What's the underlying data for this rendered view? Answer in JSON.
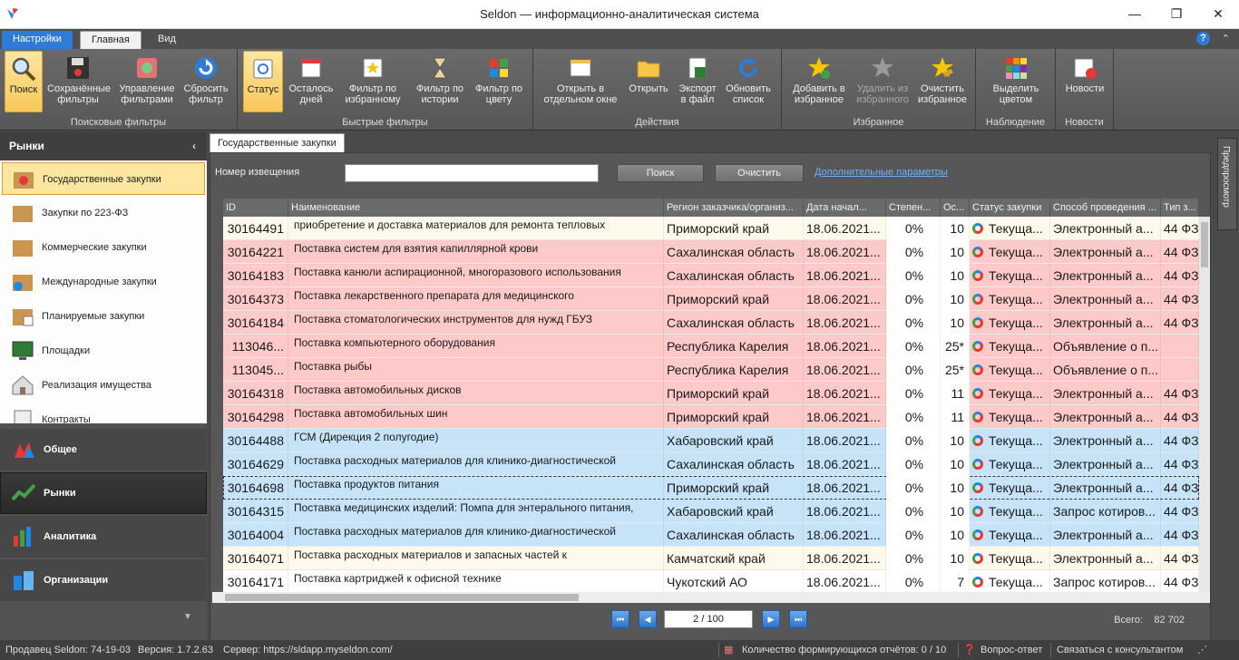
{
  "window": {
    "title": "Seldon — информационно-аналитическая система",
    "minimize": "—",
    "maximize": "❐",
    "close": "✕"
  },
  "ribbon_tabs": [
    "Настройки",
    "Главная",
    "Вид"
  ],
  "ribbon": {
    "groups": [
      {
        "label": "Поисковые фильтры",
        "buttons": [
          "Поиск",
          "Сохранённые фильтры",
          "Управление фильтрами",
          "Сбросить фильтр"
        ]
      },
      {
        "label": "Быстрые фильтры",
        "buttons": [
          "Статус",
          "Осталось дней",
          "Фильтр по избранному",
          "Фильтр по истории",
          "Фильтр по цвету"
        ]
      },
      {
        "label": "Действия",
        "buttons": [
          "Открыть в отдельном окне",
          "Открыть",
          "Экспорт в файл",
          "Обновить список"
        ]
      },
      {
        "label": "Избранное",
        "buttons": [
          "Добавить в избранное",
          "Удалить из избранного",
          "Очистить избранное"
        ]
      },
      {
        "label": "Наблюдение",
        "buttons": [
          "Выделить цветом"
        ]
      },
      {
        "label": "Новости",
        "buttons": [
          "Новости"
        ]
      }
    ]
  },
  "sidebar": {
    "header": "Рынки",
    "items": [
      "Государственные закупки",
      "Закупки по 223-ФЗ",
      "Коммерческие закупки",
      "Международные закупки",
      "Планируемые закупки",
      "Площадки",
      "Реализация имущества",
      "Контракты"
    ],
    "sections": [
      "Общее",
      "Рынки",
      "Аналитика",
      "Организации"
    ]
  },
  "doc_tab": "Государственные закупки",
  "search": {
    "label": "Номер извещения",
    "value": "",
    "search_btn": "Поиск",
    "clear_btn": "Очистить",
    "advanced": "Дополнительные параметры"
  },
  "columns": [
    "ID",
    "Наименование",
    "Регион заказчика/организ...",
    "Дата начал...",
    "Степен...",
    "Ос...",
    "Статус закупки",
    "Способ проведения ...",
    "Тип з..."
  ],
  "rows": [
    {
      "id": "30164491",
      "name": "приобретение и доставка материалов для ремонта тепловых",
      "region": "Приморский край",
      "date": "18.06.2021...",
      "pct": "0%",
      "days": "10",
      "status": "Текуща...",
      "method": "Электронный а...",
      "law": "44 ФЗ",
      "color": "#fdfaec"
    },
    {
      "id": "30164221",
      "name": "Поставка систем для взятия капиллярной крови",
      "region": "Сахалинская область",
      "date": "18.06.2021...",
      "pct": "0%",
      "days": "10",
      "status": "Текуща...",
      "method": "Электронный а...",
      "law": "44 ФЗ",
      "color": "#fdc9c9"
    },
    {
      "id": "30164183",
      "name": "Поставка канюли аспирационной, многоразового использования",
      "region": "Сахалинская область",
      "date": "18.06.2021...",
      "pct": "0%",
      "days": "10",
      "status": "Текуща...",
      "method": "Электронный а...",
      "law": "44 ФЗ",
      "color": "#fdc9c9"
    },
    {
      "id": "30164373",
      "name": "Поставка лекарственного препарата для медицинского",
      "region": "Приморский край",
      "date": "18.06.2021...",
      "pct": "0%",
      "days": "10",
      "status": "Текуща...",
      "method": "Электронный а...",
      "law": "44 ФЗ",
      "color": "#fdc9c9"
    },
    {
      "id": "30164184",
      "name": "Поставка стоматологических инструментов для нужд ГБУЗ",
      "region": "Сахалинская область",
      "date": "18.06.2021...",
      "pct": "0%",
      "days": "10",
      "status": "Текуща...",
      "method": "Электронный а...",
      "law": "44 ФЗ",
      "color": "#fdc9c9"
    },
    {
      "id": "113046...",
      "name": "Поставка компьютерного оборудования",
      "region": "Республика Карелия",
      "date": "18.06.2021...",
      "pct": "0%",
      "days": "25*",
      "status": "Текуща...",
      "method": "Объявление о п...",
      "law": "",
      "color": "#fdc9c9"
    },
    {
      "id": "113045...",
      "name": "Поставка рыбы",
      "region": "Республика Карелия",
      "date": "18.06.2021...",
      "pct": "0%",
      "days": "25*",
      "status": "Текуща...",
      "method": "Объявление о п...",
      "law": "",
      "color": "#fdc9c9"
    },
    {
      "id": "30164318",
      "name": "Поставка автомобильных дисков",
      "region": "Приморский край",
      "date": "18.06.2021...",
      "pct": "0%",
      "days": "11",
      "status": "Текуща...",
      "method": "Электронный а...",
      "law": "44 ФЗ",
      "color": "#fdc9c9"
    },
    {
      "id": "30164298",
      "name": "Поставка автомобильных шин",
      "region": "Приморский край",
      "date": "18.06.2021...",
      "pct": "0%",
      "days": "11",
      "status": "Текуща...",
      "method": "Электронный а...",
      "law": "44 ФЗ",
      "color": "#fdc9c9"
    },
    {
      "id": "30164488",
      "name": "ГСМ (Дирекция 2 полугодие)",
      "region": "Хабаровский край",
      "date": "18.06.2021...",
      "pct": "0%",
      "days": "10",
      "status": "Текуща...",
      "method": "Электронный а...",
      "law": "44 ФЗ",
      "color": "#c6e3f7"
    },
    {
      "id": "30164629",
      "name": "Поставка расходных материалов для клинико-диагностической",
      "region": "Сахалинская область",
      "date": "18.06.2021...",
      "pct": "0%",
      "days": "10",
      "status": "Текуща...",
      "method": "Электронный а...",
      "law": "44 ФЗ",
      "color": "#c6e3f7"
    },
    {
      "id": "30164698",
      "name": "Поставка продуктов питания",
      "region": "Приморский край",
      "date": "18.06.2021...",
      "pct": "0%",
      "days": "10",
      "status": "Текуща...",
      "method": "Электронный а...",
      "law": "44 ФЗ",
      "color": "#c6e3f7"
    },
    {
      "id": "30164315",
      "name": "Поставка медицинских изделий: Помпа для энтерального питания,",
      "region": "Хабаровский край",
      "date": "18.06.2021...",
      "pct": "0%",
      "days": "10",
      "status": "Текуща...",
      "method": "Запрос котиров...",
      "law": "44 ФЗ",
      "color": "#c6e3f7"
    },
    {
      "id": "30164004",
      "name": "Поставка расходных материалов для клинико-диагностической",
      "region": "Сахалинская область",
      "date": "18.06.2021...",
      "pct": "0%",
      "days": "10",
      "status": "Текуща...",
      "method": "Электронный а...",
      "law": "44 ФЗ",
      "color": "#c6e3f7"
    },
    {
      "id": "30164071",
      "name": "Поставка расходных материалов и запасных частей к",
      "region": "Камчатский край",
      "date": "18.06.2021...",
      "pct": "0%",
      "days": "10",
      "status": "Текуща...",
      "method": "Электронный а...",
      "law": "44 ФЗ",
      "color": "#fdfaec"
    },
    {
      "id": "30164171",
      "name": "Поставка картриджей к офисной технике",
      "region": "Чукотский АО",
      "date": "18.06.2021...",
      "pct": "0%",
      "days": "7",
      "status": "Текуща...",
      "method": "Запрос котиров...",
      "law": "44 ФЗ",
      "color": "#ffffff"
    }
  ],
  "current_row": 11,
  "pager": {
    "page": "2 / 100",
    "total_label": "Всего:",
    "total_value": "82 702"
  },
  "preview_panel": "Предпросмотр",
  "status": {
    "seller": "Продавец Seldon: 74-19-03",
    "version": "Версия: 1.7.2.63",
    "server": "Сервер: https://sldapp.myseldon.com/",
    "reports": "Количество формирующихся отчётов: 0 / 10",
    "qa": "Вопрос-ответ",
    "consult": "Связаться с консультантом"
  }
}
